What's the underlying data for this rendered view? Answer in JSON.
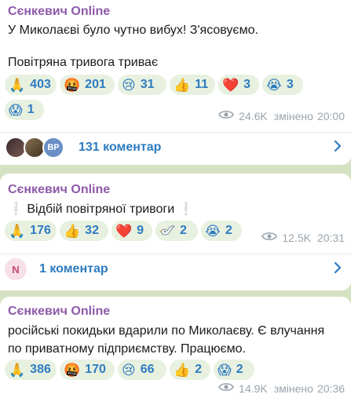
{
  "posts": [
    {
      "author": "Сєнкевич Online",
      "lines": [
        "У Миколаєві було чутно вибух! З'ясовуємо.",
        "Повітряна тривога триває"
      ],
      "reactions": [
        {
          "emoji": "🙏",
          "count": "403"
        },
        {
          "emoji": "🤬",
          "count": "201"
        },
        {
          "emoji": "😢",
          "count": "31"
        },
        {
          "emoji": "👍",
          "count": "11"
        },
        {
          "emoji": "❤️",
          "count": "3"
        },
        {
          "emoji": "😭",
          "count": "3"
        },
        {
          "emoji": "😱",
          "count": "1"
        }
      ],
      "views": "24.6K",
      "edited_label": "змінено",
      "time": "20:00",
      "comments": "131 коментар"
    },
    {
      "author": "Сєнкевич Online",
      "text": "Відбій повітряної тривоги",
      "exclaim": "❕",
      "reactions": [
        {
          "emoji": "🙏",
          "count": "176"
        },
        {
          "emoji": "👍",
          "count": "32"
        },
        {
          "emoji": "❤️",
          "count": "9"
        },
        {
          "emoji": "🕊",
          "count": "2"
        },
        {
          "emoji": "😭",
          "count": "2"
        }
      ],
      "views": "12.5K",
      "time": "20:31",
      "comments": "1 коментар",
      "avatar_letter": "N"
    },
    {
      "author": "Сєнкевич Online",
      "text": "російські покидьки вдарили по Миколаєву. Є влучання по приватному підприємству. Працюємо.",
      "reactions": [
        {
          "emoji": "🙏",
          "count": "386"
        },
        {
          "emoji": "🤬",
          "count": "170"
        },
        {
          "emoji": "😢",
          "count": "66"
        },
        {
          "emoji": "👍",
          "count": "2"
        },
        {
          "emoji": "😱",
          "count": "2"
        }
      ],
      "views": "14.9K",
      "edited_label": "змінено",
      "time": "20:36"
    }
  ],
  "avatars": {
    "third_initials": "ВР"
  },
  "colors": {
    "accent": "#2d7bc0",
    "author": "#8e5aa8",
    "background": "#d6e2c4",
    "chip": "#e8f1e0"
  },
  "icons": {
    "views": "eye-icon",
    "open_comments": "chevron-right-icon"
  }
}
